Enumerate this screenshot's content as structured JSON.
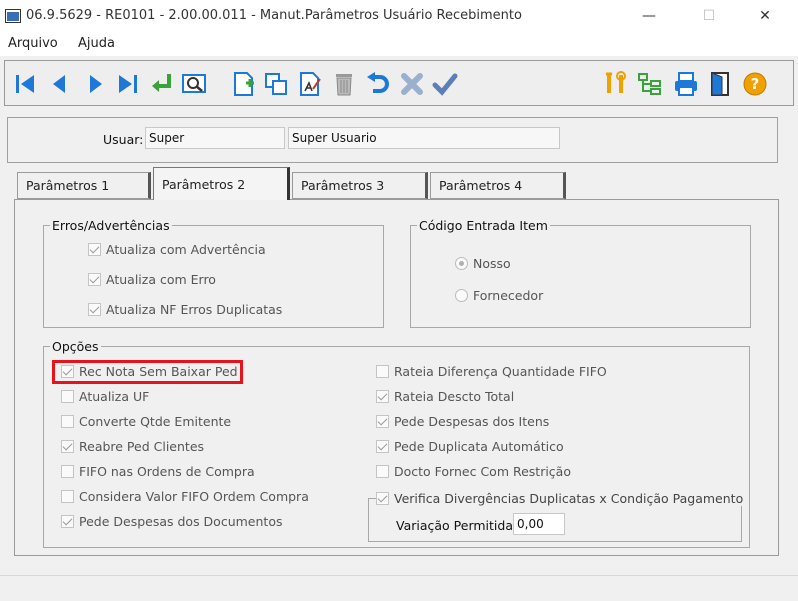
{
  "window": {
    "title": "06.9.5629 - RE0101 - 2.00.00.011 - Manut.Parâmetros Usuário Recebimento",
    "minimize": "—",
    "maximize": "☐",
    "close": "✕"
  },
  "menu": {
    "items": [
      "Arquivo",
      "Ajuda"
    ]
  },
  "user": {
    "label": "Usuar:",
    "code": "Super",
    "name": "Super Usuario"
  },
  "tabs": [
    "Parâmetros 1",
    "Parâmetros 2",
    "Parâmetros 3",
    "Parâmetros 4"
  ],
  "active_tab": "Parâmetros 2",
  "errors_group": {
    "legend": "Erros/Advertências",
    "items": [
      {
        "label": "Atualiza com Advertência",
        "checked": true
      },
      {
        "label": "Atualiza com Erro",
        "checked": true
      },
      {
        "label": "Atualiza NF Erros Duplicatas",
        "checked": true
      }
    ]
  },
  "entry_code_group": {
    "legend": "Código Entrada Item",
    "options": [
      {
        "label": "Nosso",
        "selected": true
      },
      {
        "label": "Fornecedor",
        "selected": false
      }
    ]
  },
  "options_group": {
    "legend": "Opções",
    "left": [
      {
        "label": "Rec Nota Sem Baixar Ped",
        "checked": true
      },
      {
        "label": "Atualiza UF",
        "checked": false
      },
      {
        "label": "Converte Qtde Emitente",
        "checked": false
      },
      {
        "label": "Reabre Ped Clientes",
        "checked": true
      },
      {
        "label": "FIFO nas Ordens de Compra",
        "checked": false
      },
      {
        "label": "Considera Valor FIFO Ordem Compra",
        "checked": false
      },
      {
        "label": "Pede Despesas dos Documentos",
        "checked": true
      }
    ],
    "right": [
      {
        "label": "Rateia Diferença Quantidade FIFO",
        "checked": false
      },
      {
        "label": "Rateia Descto Total",
        "checked": true
      },
      {
        "label": "Pede Despesas dos Itens",
        "checked": true
      },
      {
        "label": "Pede Duplicata Automático",
        "checked": true
      },
      {
        "label": "Docto Fornec Com Restrição",
        "checked": false
      }
    ],
    "divergence": {
      "label": "Verifica Divergências Duplicatas x Condição Pagamento",
      "checked": true,
      "tolerance_label": "Variação Permitida:",
      "tolerance_value": "0,00"
    }
  },
  "colors": {
    "highlight": "#e8131a",
    "icon_blue": "#1e78d8",
    "icon_orange": "#f0a000"
  }
}
